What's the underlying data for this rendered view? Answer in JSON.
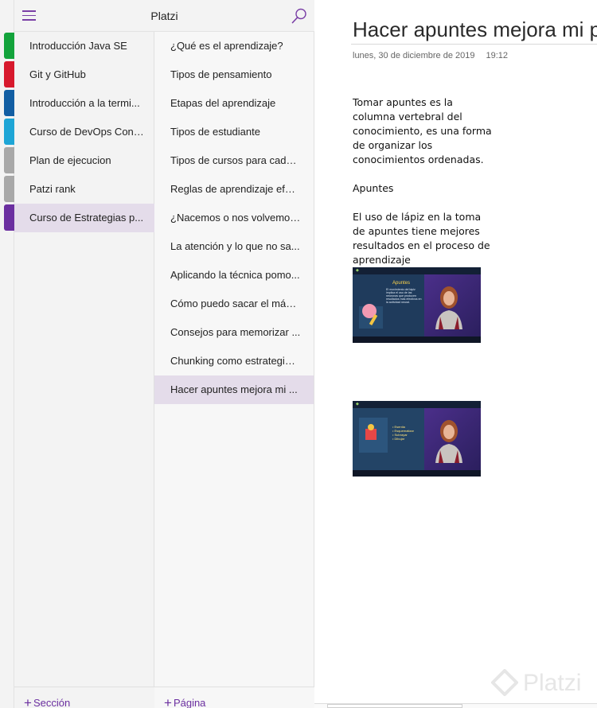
{
  "header": {
    "notebook_title": "Platzi",
    "menu_icon": "hamburger-menu-icon",
    "search_icon": "search-icon"
  },
  "tabs": [
    {
      "color": "#13a33b"
    },
    {
      "color": "#d7192d"
    },
    {
      "color": "#125ea3"
    },
    {
      "color": "#1ea5d6"
    },
    {
      "color": "#a8a8a8"
    },
    {
      "color": "#a8a8a8"
    },
    {
      "color": "#6b2fa0"
    }
  ],
  "sections": [
    {
      "label": "Introducción Java SE"
    },
    {
      "label": "Git y GitHub"
    },
    {
      "label": "Introducción a la termi..."
    },
    {
      "label": "Curso de DevOps Con ..."
    },
    {
      "label": "Plan de ejecucion"
    },
    {
      "label": "Patzi rank"
    },
    {
      "label": "Curso de Estrategias p...",
      "active": true
    }
  ],
  "pages": [
    {
      "label": "¿Qué es el aprendizaje?"
    },
    {
      "label": "Tipos de pensamiento"
    },
    {
      "label": "Etapas del aprendizaje"
    },
    {
      "label": "Tipos de estudiante"
    },
    {
      "label": "Tipos de cursos para cada ..."
    },
    {
      "label": "Reglas de aprendizaje efec..."
    },
    {
      "label": "¿Nacemos o nos volvemos..."
    },
    {
      "label": "La atención y lo que no sa..."
    },
    {
      "label": "Aplicando la técnica pomo..."
    },
    {
      "label": "Cómo puedo sacar el máxi..."
    },
    {
      "label": "Consejos para memorizar ..."
    },
    {
      "label": "Chunking como estrategia ..."
    },
    {
      "label": "Hacer apuntes mejora mi ...",
      "active": true
    }
  ],
  "footer": {
    "add_section": "Sección",
    "add_page": "Página"
  },
  "page": {
    "title": "Hacer apuntes mejora mi pro",
    "date": "lunes, 30 de diciembre de 2019",
    "time": "19:12",
    "paragraph1": "Tomar apuntes es la columna vertebral del conocimiento, es una forma de organizar los conocimientos ordenadas.",
    "paragraph2": "Apuntes",
    "paragraph3": "El uso de lápiz en la toma de apuntes tiene mejores resultados en el proceso de aprendizaje",
    "thumb1": {
      "slide_title": "Apuntes",
      "slide_text": "El movimiento del lápiz implica el uso de las neuronas que producen resultados más efectivos en la actividad neural."
    },
    "thumb2": {
      "list": [
        "Esentia",
        "Esquematizar",
        "Subrayar",
        "Dibujar"
      ]
    }
  },
  "watermark": "Platzi"
}
